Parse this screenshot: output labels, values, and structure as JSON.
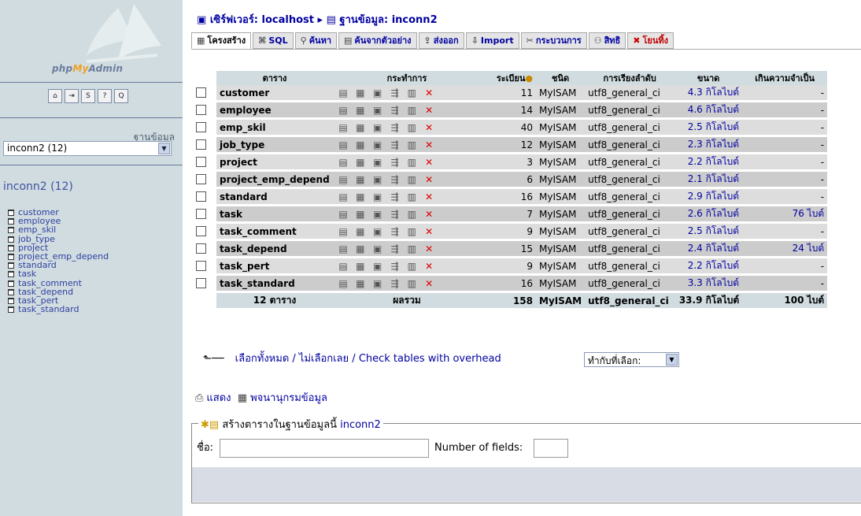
{
  "left": {
    "logo": {
      "php": "php",
      "my": "My",
      "admin": "Admin"
    },
    "icons": [
      "home-icon",
      "exit-icon",
      "sql-icon",
      "docs-icon",
      "sql-query-icon"
    ],
    "icon_glyphs": [
      "⌂",
      "⇥",
      "S",
      "?",
      "Q"
    ],
    "db_label": "ฐานข้อมูล",
    "db_select": "inconn2 (12)",
    "db_name": "inconn2 (12)",
    "tables": [
      "customer",
      "employee",
      "emp_skil",
      "job_type",
      "project",
      "project_emp_depend",
      "standard",
      "task",
      "task_comment",
      "task_depend",
      "task_pert",
      "task_standard"
    ]
  },
  "breadcrumb": {
    "server": "เซิร์ฟเวอร์: localhost",
    "sep": "▸",
    "db": "ฐานข้อมูล: inconn2"
  },
  "tabs": [
    {
      "label": "โครงสร้าง",
      "icon": "▦"
    },
    {
      "label": "SQL",
      "icon": "⌘"
    },
    {
      "label": "ค้นหา",
      "icon": "⚲"
    },
    {
      "label": "ค้นจากตัวอย่าง",
      "icon": "▤"
    },
    {
      "label": "ส่งออก",
      "icon": "⇪"
    },
    {
      "label": "Import",
      "icon": "⇩"
    },
    {
      "label": "กระบวนการ",
      "icon": "✂"
    },
    {
      "label": "สิทธิ",
      "icon": "⚇"
    },
    {
      "label": "โยนทิ้ง",
      "icon": "✖"
    }
  ],
  "table": {
    "headers": [
      "ตาราง",
      "กระทำการ",
      "ระเบียน",
      "ชนิด",
      "การเรียงลำดับ",
      "ขนาด",
      "เกินความจำเป็น"
    ],
    "rows": [
      {
        "name": "customer",
        "records": "11",
        "type": "MyISAM",
        "collation": "utf8_general_ci",
        "size": "4.3 กิโลไบต์",
        "overhead": "-"
      },
      {
        "name": "employee",
        "records": "14",
        "type": "MyISAM",
        "collation": "utf8_general_ci",
        "size": "4.6 กิโลไบต์",
        "overhead": "-"
      },
      {
        "name": "emp_skil",
        "records": "40",
        "type": "MyISAM",
        "collation": "utf8_general_ci",
        "size": "2.5 กิโลไบต์",
        "overhead": "-"
      },
      {
        "name": "job_type",
        "records": "12",
        "type": "MyISAM",
        "collation": "utf8_general_ci",
        "size": "2.3 กิโลไบต์",
        "overhead": "-"
      },
      {
        "name": "project",
        "records": "3",
        "type": "MyISAM",
        "collation": "utf8_general_ci",
        "size": "2.2 กิโลไบต์",
        "overhead": "-"
      },
      {
        "name": "project_emp_depend",
        "records": "6",
        "type": "MyISAM",
        "collation": "utf8_general_ci",
        "size": "2.1 กิโลไบต์",
        "overhead": "-"
      },
      {
        "name": "standard",
        "records": "16",
        "type": "MyISAM",
        "collation": "utf8_general_ci",
        "size": "2.9 กิโลไบต์",
        "overhead": "-"
      },
      {
        "name": "task",
        "records": "7",
        "type": "MyISAM",
        "collation": "utf8_general_ci",
        "size": "2.6 กิโลไบต์",
        "overhead": "76 ไบต์"
      },
      {
        "name": "task_comment",
        "records": "9",
        "type": "MyISAM",
        "collation": "utf8_general_ci",
        "size": "2.5 กิโลไบต์",
        "overhead": "-"
      },
      {
        "name": "task_depend",
        "records": "15",
        "type": "MyISAM",
        "collation": "utf8_general_ci",
        "size": "2.4 กิโลไบต์",
        "overhead": "24 ไบต์"
      },
      {
        "name": "task_pert",
        "records": "9",
        "type": "MyISAM",
        "collation": "utf8_general_ci",
        "size": "2.2 กิโลไบต์",
        "overhead": "-"
      },
      {
        "name": "task_standard",
        "records": "16",
        "type": "MyISAM",
        "collation": "utf8_general_ci",
        "size": "3.3 กิโลไบต์",
        "overhead": "-"
      }
    ],
    "footer": {
      "count": "12 ตาราง",
      "sum_label": "ผลรวม",
      "records": "158",
      "type": "MyISAM",
      "collation": "utf8_general_ci",
      "size": "33.9 กิโลไบต์",
      "overhead": "100 ไบต์"
    }
  },
  "below": {
    "check_all": "เลือกทั้งหมด",
    "sep": " / ",
    "uncheck_all": "ไม่เลือกเลย",
    "check_overhead": "Check tables with overhead",
    "with_selected": "ทำกับที่เลือก:"
  },
  "links": {
    "print": "แสดง",
    "dictionary": "พจนานุกรมข้อมูล"
  },
  "create": {
    "legend": "สร้างตารางในฐานข้อมูลนี้",
    "db": "inconn2",
    "name_label": "ชื่อ:",
    "fields_label": "Number of fields:"
  }
}
